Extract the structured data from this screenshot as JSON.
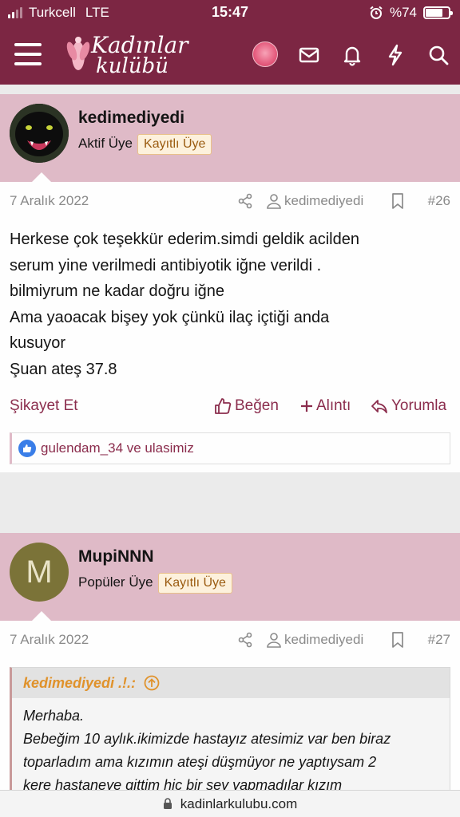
{
  "status_bar": {
    "carrier": "Turkcell",
    "network": "LTE",
    "time": "15:47",
    "battery": "%74",
    "battery_level": 0.74
  },
  "header": {
    "logo_line1": "Kadınlar",
    "logo_line2": "kulübü",
    "icons": [
      "menu-icon",
      "mail-icon",
      "bell-icon",
      "bolt-icon",
      "search-icon"
    ]
  },
  "posts": [
    {
      "username": "kedimediyedi",
      "role": "Aktif Üye",
      "badge": "Kayıtlı Üye",
      "date": "7 Aralık 2022",
      "author": "kedimediyedi",
      "number": "#26",
      "message_lines": [
        "Herkese çok teşekkür ederim.simdi geldik acilden",
        "serum yine verilmedi antibiyotik iğne verildi .",
        "bilmiyrum ne kadar doğru iğne",
        "Ama yaoacak bişey yok çünkü ilaç içtiği anda",
        "kusuyor",
        "Şuan ateş 37.8"
      ],
      "actions": {
        "report": "Şikayet Et",
        "like": "Beğen",
        "quote": "Alıntı",
        "reply": "Yorumla"
      },
      "reactions": "gulendam_34 ve ulasimiz"
    },
    {
      "username": "MupiNNN",
      "avatar_letter": "M",
      "role": "Popüler Üye",
      "badge": "Kayıtlı Üye",
      "date": "7 Aralık 2022",
      "author": "kedimediyedi",
      "number": "#27",
      "quote": {
        "author": "kedimediyedi .!.:",
        "lines": [
          "Merhaba.",
          "Bebeğim 10 aylık.ikimizde hastayız atesimiz var ben biraz",
          "toparladım ama kızımın ateşi düşmüyor ne yaptıysam 2",
          "kere hastaneye gittim hiç bir şey yapmadılar kızım"
        ]
      }
    }
  ],
  "url_bar": {
    "domain": "kadinlarkulubu.com"
  },
  "colors": {
    "header": "#7c2643",
    "post_head": "#dfbac7",
    "accent": "#8b2d4d",
    "badge_text": "#9a5b10",
    "quote_author": "#e0922b"
  }
}
